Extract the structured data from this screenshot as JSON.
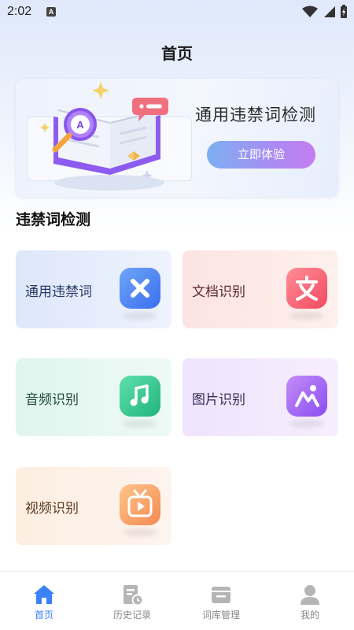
{
  "status_bar": {
    "time": "2:02",
    "notification_letter": "A"
  },
  "header": {
    "title": "首页"
  },
  "banner": {
    "title": "通用违禁词检测",
    "button_label": "立即体验"
  },
  "section": {
    "title": "违禁词检测"
  },
  "cards": [
    {
      "label": "通用违禁词",
      "icon": "x-icon",
      "color": "#3a6ff0"
    },
    {
      "label": "文档识别",
      "icon": "document-text-icon",
      "color": "#f24a60"
    },
    {
      "label": "音频识别",
      "icon": "music-note-icon",
      "color": "#20b47a"
    },
    {
      "label": "图片识别",
      "icon": "image-icon",
      "color": "#8a4df0"
    },
    {
      "label": "视频识别",
      "icon": "video-play-icon",
      "color": "#f48a52"
    }
  ],
  "bottom_nav": {
    "items": [
      {
        "label": "首页",
        "icon": "home-icon",
        "active": true
      },
      {
        "label": "历史记录",
        "icon": "history-icon",
        "active": false
      },
      {
        "label": "词库管理",
        "icon": "word-library-icon",
        "active": false
      },
      {
        "label": "我的",
        "icon": "profile-icon",
        "active": false
      }
    ],
    "active_color": "#3b82f6",
    "inactive_color": "#b5b5b5"
  }
}
